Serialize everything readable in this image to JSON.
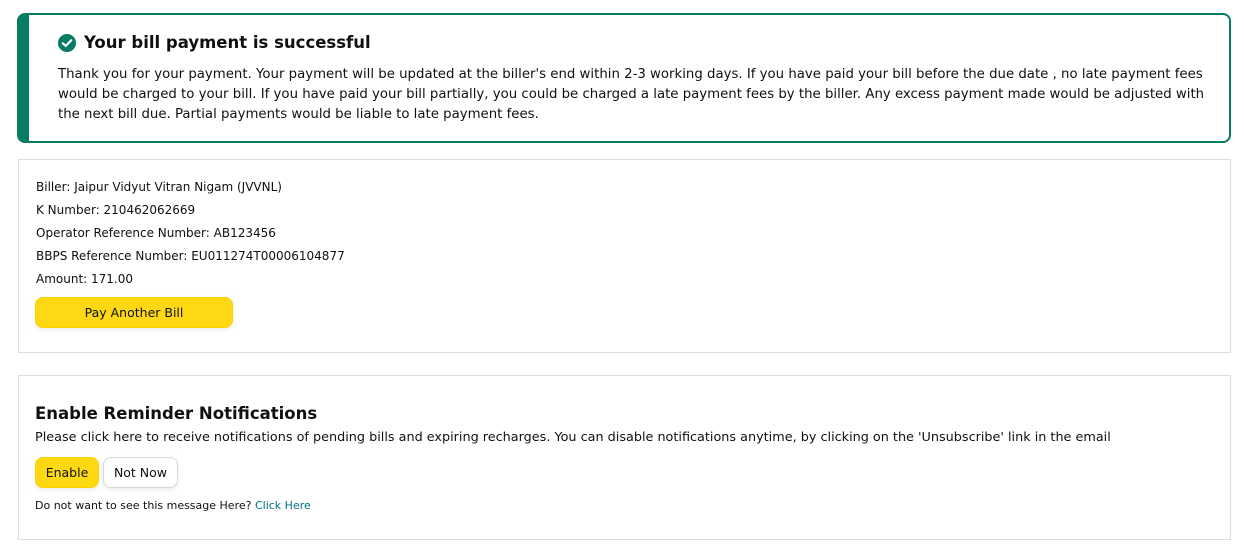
{
  "alert": {
    "title": "Your bill payment is successful",
    "message": "Thank you for your payment. Your payment will be updated at the biller's end within 2-3 working days. If you have paid your bill before the due date , no late payment fees would be charged to your bill. If you have paid your bill partially, you could be charged a late payment fees by the biller. Any excess payment made would be adjusted with the next bill due. Partial payments would be liable to late payment fees.",
    "icon": "check-circle-icon",
    "accent_color": "#067d62"
  },
  "details": {
    "biller": "Biller: Jaipur Vidyut Vitran Nigam (JVVNL)",
    "k_number": "K Number: 210462062669",
    "operator_ref": "Operator Reference Number: AB123456",
    "bbps_ref": "BBPS Reference Number: EU011274T00006104877",
    "amount": "Amount: 171.00",
    "pay_another_label": "Pay Another Bill"
  },
  "reminder": {
    "title": "Enable Reminder Notifications",
    "description": "Please click here to receive notifications of pending bills and expiring recharges. You can disable notifications anytime, by clicking on the 'Unsubscribe' link in the email",
    "enable_label": "Enable",
    "not_now_label": "Not Now",
    "hide_prompt": "Do not want to see this message Here?",
    "hide_link": "Click Here"
  },
  "colors": {
    "primary_button": "#ffd814",
    "link": "#007185"
  }
}
